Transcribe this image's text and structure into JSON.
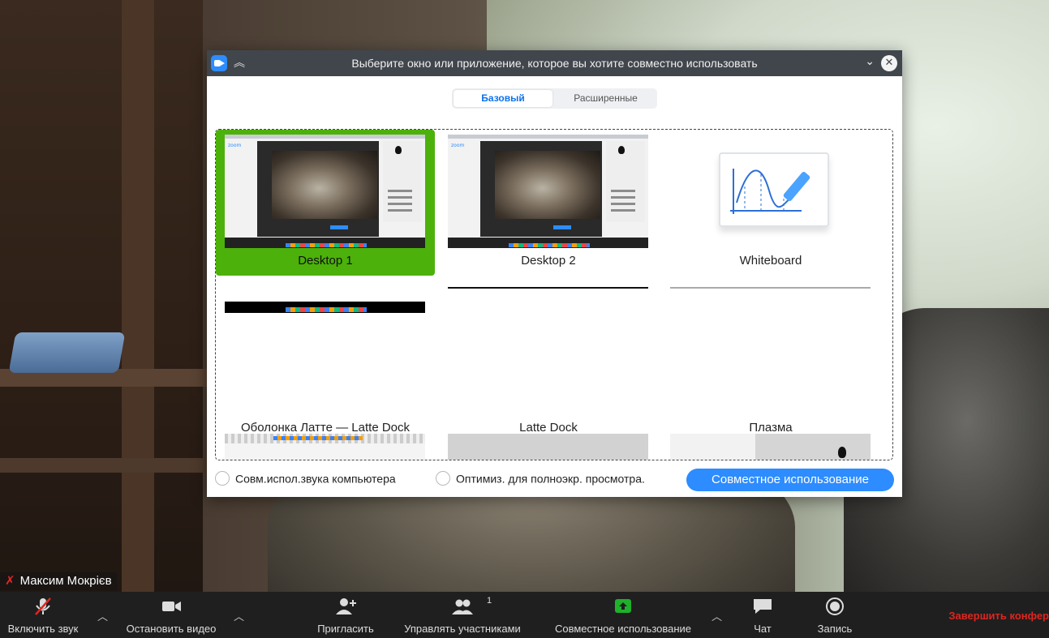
{
  "modal": {
    "title": "Выберите окно или приложение, которое вы хотите совместно использовать",
    "tabs": [
      {
        "label": "Базовый"
      },
      {
        "label": "Расширенные"
      }
    ],
    "tiles": [
      {
        "label": "Desktop 1"
      },
      {
        "label": "Desktop 2"
      },
      {
        "label": "Whiteboard"
      },
      {
        "label": "Оболонка Латте — Latte Dock"
      },
      {
        "label": "Latte Dock"
      },
      {
        "label": "Плазма"
      }
    ],
    "options": {
      "computer_sound": "Совм.испол.звука компьютера",
      "optimize_fullscreen": "Оптимиз. для полноэкр. просмотра."
    },
    "share_button": "Совместное использование",
    "zoom_thumb_text": "zoom"
  },
  "participant": {
    "name": "Максим Мокрієв"
  },
  "toolbar": {
    "unmute": "Включить звук",
    "stop_video": "Остановить видео",
    "invite": "Пригласить",
    "manage_participants": "Управлять участниками",
    "participants_count": "1",
    "share": "Совместное использование",
    "chat": "Чат",
    "record": "Запись",
    "end": "Завершить конфер"
  },
  "colors": {
    "accent": "#2d8cff",
    "selected": "#4cb10a",
    "end": "#e0251f",
    "share_green": "#1fb12b"
  }
}
